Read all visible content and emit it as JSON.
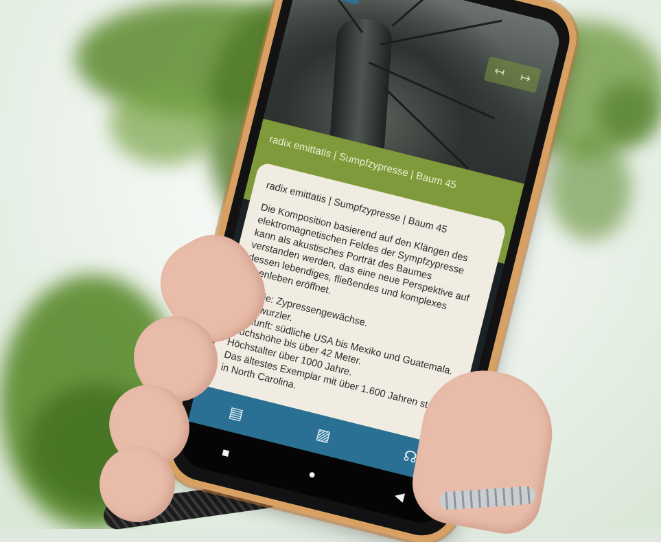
{
  "app": {
    "header_band_title": "radix emittatis | Sumpfzypresse | Baum 45",
    "icons": {
      "menu": "menu-icon",
      "share": "share-icon",
      "prev": "arrow-left-icon",
      "next": "arrow-right-icon",
      "expand": "expand-icon",
      "collapse": "collapse-icon",
      "document": "document-icon",
      "image": "image-icon",
      "audio": "headphones-icon"
    },
    "glyphs": {
      "menu": "≡",
      "share": "⋈",
      "prev": "↤",
      "next": "↦",
      "expand": "⤢",
      "collapse": "⇲",
      "document": "▤",
      "image": "▨",
      "audio": "☊",
      "sys_back": "◀",
      "sys_home": "●",
      "sys_recent": "■"
    },
    "card": {
      "title": "radix emittatis | Sumpfzypresse | Baum 45",
      "description": "Die Komposition basierend auf den Klängen des elektromagnetischen Feldes der Sympfzypresse kann als akustisches Porträt des Baumes verstanden werden, das eine neue Perspektive auf dessen lebendiges, fließendes und komplexes Innenleben eröffnet.",
      "facts": [
        "Familie: Zypressengewächse.",
        "Atemwurzler.",
        "Herkunft: südliche USA bis Mexiko und Guatemala.",
        "Wuchshöhe bis über 42 Meter.",
        "Höchstalter über 1000 Jahre.",
        "Das ältestes Exemplar mit über 1.600 Jahren steht in North Carolina."
      ]
    },
    "colors": {
      "accent_green": "#7e9a3a",
      "bottom_bar_blue": "#2a6f94",
      "card_bg": "#f1ece2",
      "phone_frame": "#d9a064"
    }
  }
}
